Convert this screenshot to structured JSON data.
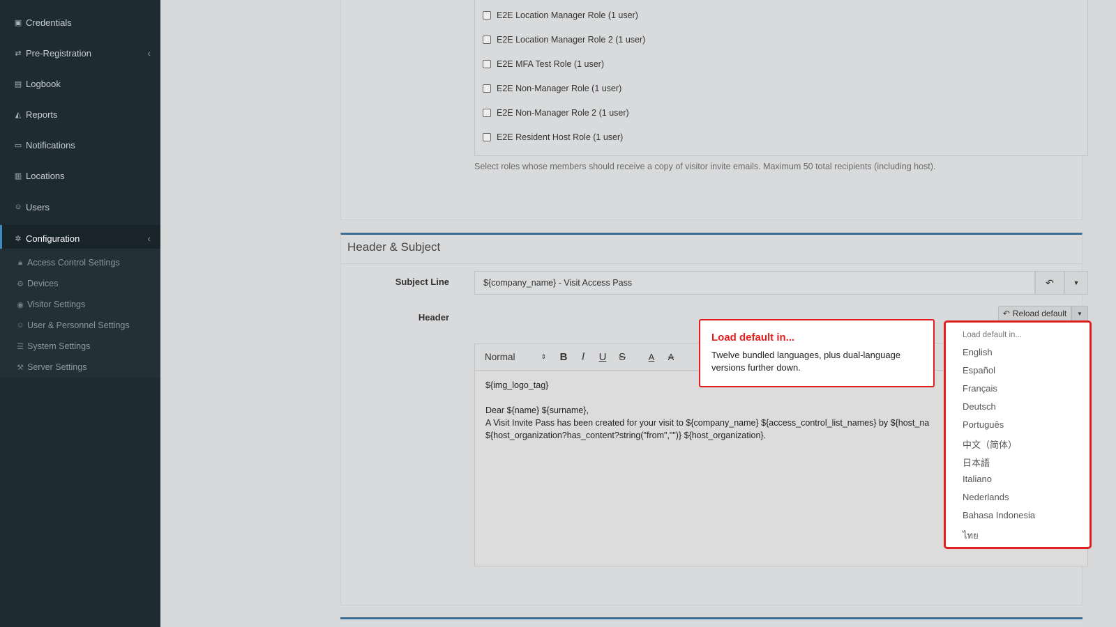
{
  "sidebar": {
    "items": [
      {
        "label": "Credentials",
        "icon": "id-card-icon"
      },
      {
        "label": "Pre-Registration",
        "icon": "exchange-icon",
        "has_chevron": true
      },
      {
        "label": "Logbook",
        "icon": "book-icon"
      },
      {
        "label": "Reports",
        "icon": "chart-icon"
      },
      {
        "label": "Notifications",
        "icon": "comments-icon"
      },
      {
        "label": "Locations",
        "icon": "building-icon"
      },
      {
        "label": "Users",
        "icon": "users-icon"
      },
      {
        "label": "Configuration",
        "icon": "gear-icon",
        "has_chevron": true,
        "active": true
      }
    ],
    "subitems": [
      {
        "label": "Access Control Settings",
        "icon": "lock-icon"
      },
      {
        "label": "Devices",
        "icon": "device-icon"
      },
      {
        "label": "Visitor Settings",
        "icon": "eye-icon"
      },
      {
        "label": "User & Personnel Settings",
        "icon": "user-cog-icon"
      },
      {
        "label": "System Settings",
        "icon": "sliders-icon"
      },
      {
        "label": "Server Settings",
        "icon": "server-cog-icon"
      }
    ]
  },
  "roles": {
    "items": [
      "E2E Location Manager Role (1 user)",
      "E2E Location Manager Role 2 (1 user)",
      "E2E MFA Test Role (1 user)",
      "E2E Non-Manager Role (1 user)",
      "E2E Non-Manager Role 2 (1 user)",
      "E2E Resident Host Role (1 user)"
    ],
    "help": "Select roles whose members should receive a copy of visitor invite emails. Maximum 50 total recipients (including host)."
  },
  "header_subject": {
    "title": "Header & Subject",
    "subject_label": "Subject Line",
    "subject_value": "${company_name} - Visit Access Pass",
    "header_label": "Header",
    "reload_label": "Reload default",
    "toolbar": {
      "format_select": "Normal",
      "bold": "B",
      "italic": "I",
      "underline": "U",
      "strike": "S",
      "font_color": "A",
      "clear_format": "A"
    },
    "editor_lines": [
      "${img_logo_tag}",
      "",
      "Dear ${name} ${surname},",
      "A Visit Invite Pass has been created for your visit to ${company_name} ${access_control_list_names} by ${host_na",
      "${host_organization?has_content?string(\"from\",\"\")} ${host_organization}."
    ]
  },
  "callout": {
    "title": "Load default in...",
    "text": "Twelve bundled languages, plus dual-language versions further down."
  },
  "dropdown": {
    "header": "Load default in...",
    "options": [
      "English",
      "Español",
      "Français",
      "Deutsch",
      "Português",
      "中文（简体）",
      "日本語",
      "Italiano",
      "Nederlands",
      "Bahasa Indonesia",
      "ไทย"
    ]
  },
  "colors": {
    "sidebar_bg": "#1f2b33",
    "accent_blue": "#3c6d95",
    "highlight_red": "#e0201f"
  }
}
